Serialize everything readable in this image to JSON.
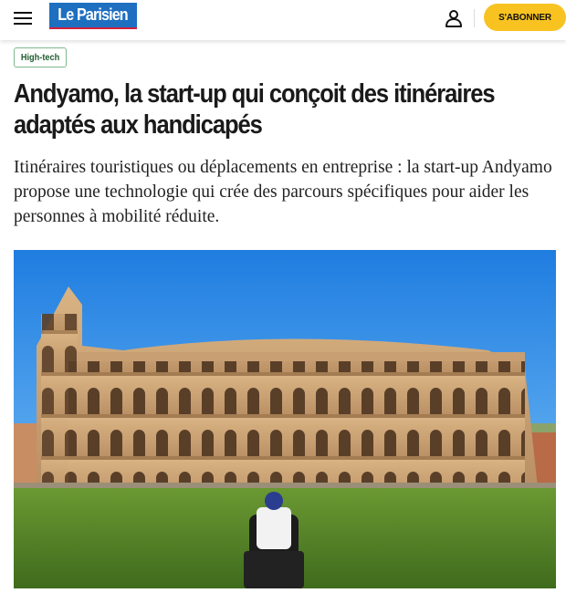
{
  "header": {
    "logo_text": "Le Parisien",
    "subscribe_label": "S'ABONNER",
    "brand_color": "#1e6fc0",
    "accent_color": "#f8c321",
    "icons": [
      "menu-icon",
      "account-icon"
    ]
  },
  "article": {
    "tag": "High-tech",
    "title": "Andyamo, la start-up qui conçoit des itinéraires adaptés aux handicapés",
    "lead": "Itinéraires touristiques ou déplacements en entreprise : la start-up Andyamo propose une technologie qui crée des parcours spécifiques pour aider les personnes à mobilité réduite."
  }
}
